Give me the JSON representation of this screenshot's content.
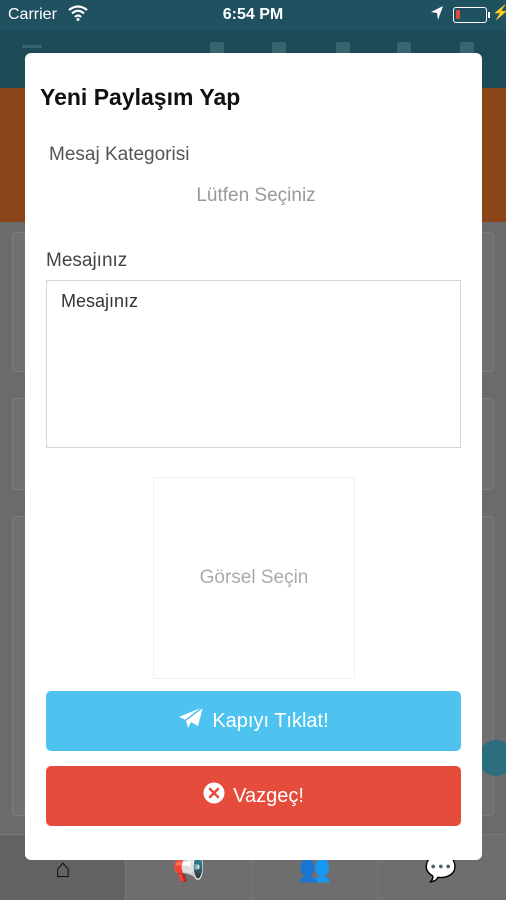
{
  "status_bar": {
    "carrier": "Carrier",
    "time": "6:54 PM",
    "battery_level": 0.15
  },
  "modal": {
    "title": "Yeni Paylaşım Yap",
    "category_label": "Mesaj Kategorisi",
    "category_select": "Lütfen Seçiniz",
    "message_label": "Mesajınız",
    "message_placeholder": "Mesajınız",
    "image_picker": "Görsel Seçin",
    "submit_button": "Kapıyı Tıklat!",
    "cancel_button": "Vazgeç!"
  },
  "colors": {
    "submit": "#4ec3ef",
    "cancel": "#e54c3c",
    "header": "#205160"
  }
}
